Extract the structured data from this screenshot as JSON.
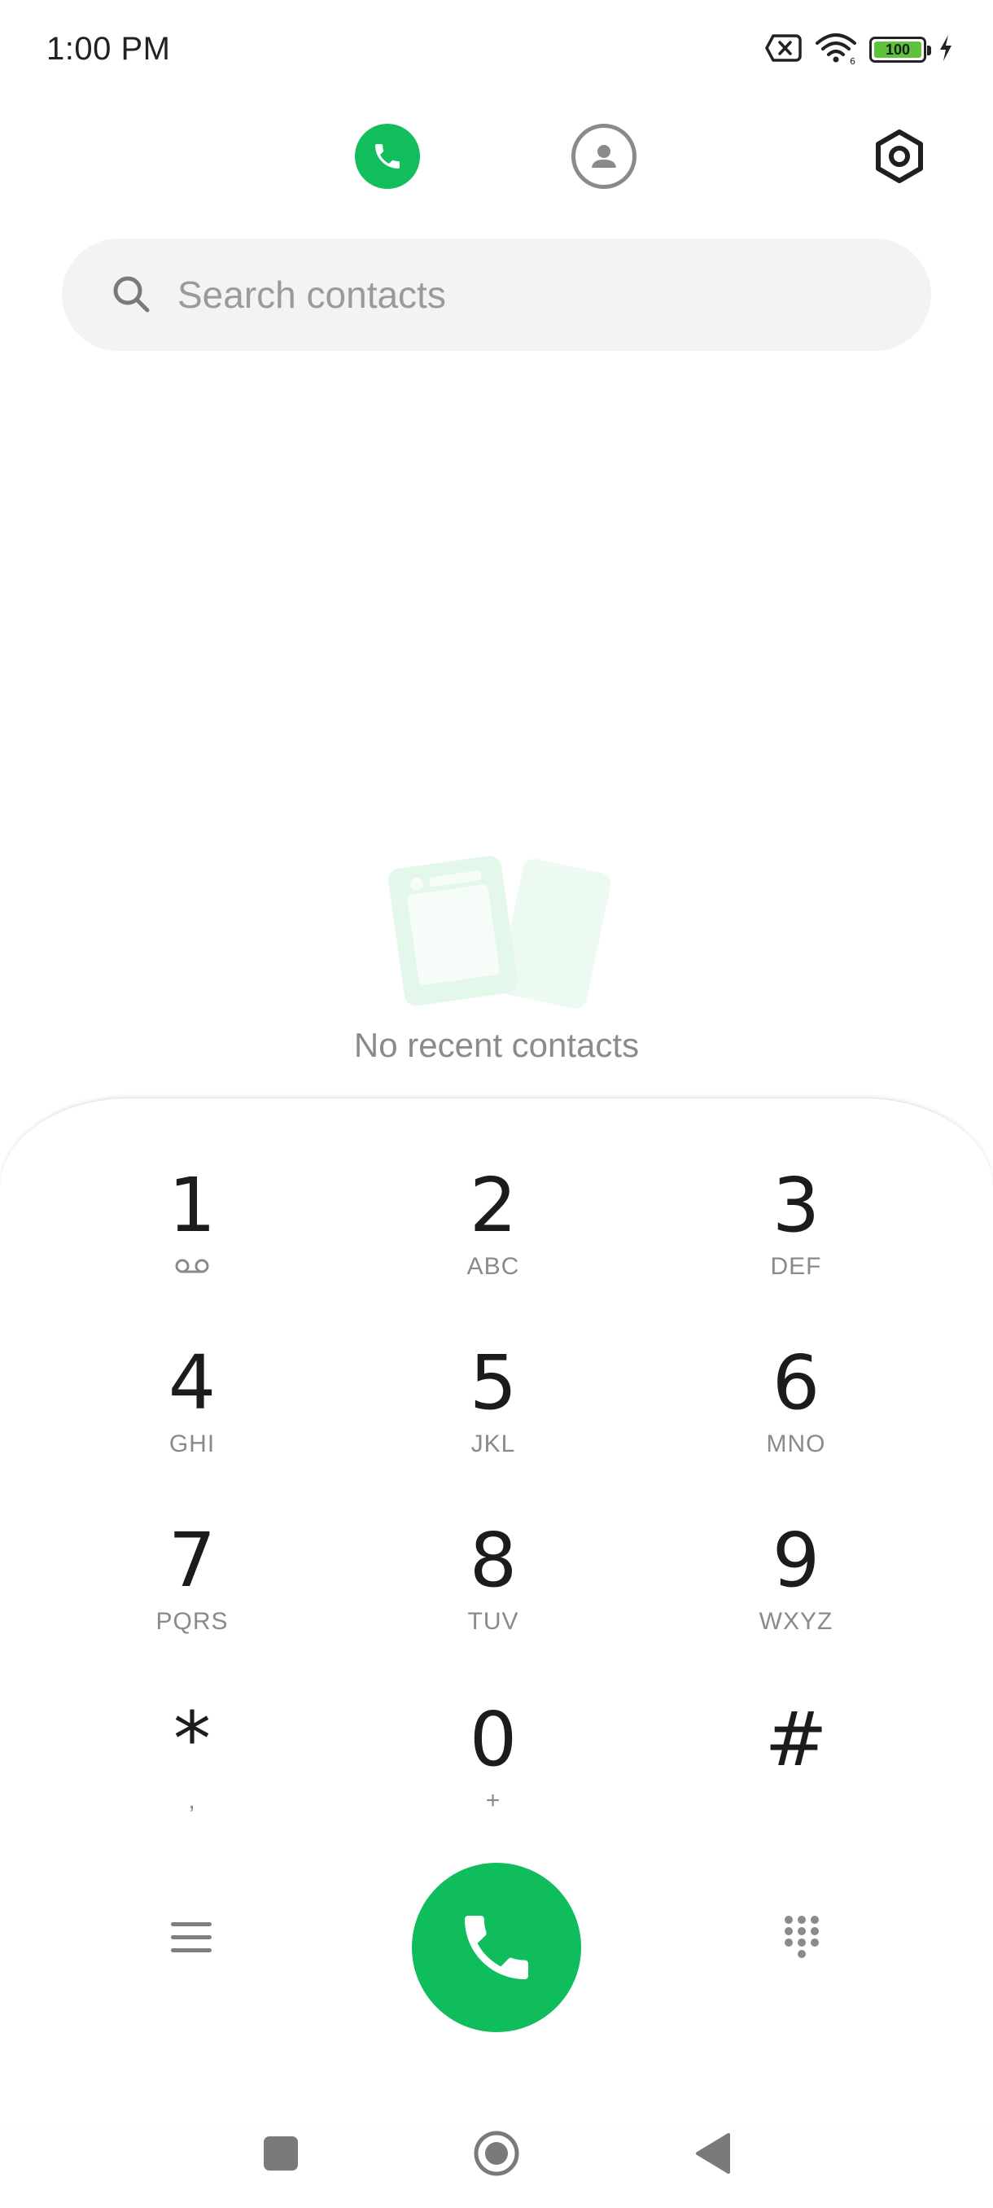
{
  "status_bar": {
    "time": "1:00 PM",
    "battery_level": "100",
    "icons": [
      "no-sim-icon",
      "wifi-icon",
      "battery-icon",
      "charging-icon"
    ]
  },
  "top_nav": {
    "tabs": [
      {
        "name": "recents",
        "icon": "phone-icon",
        "active": true
      },
      {
        "name": "contacts",
        "icon": "contact-icon",
        "active": false
      }
    ],
    "settings_icon": "gear-icon"
  },
  "search": {
    "placeholder": "Search contacts",
    "value": ""
  },
  "empty_state": {
    "text": "No recent contacts"
  },
  "dialpad": {
    "keys": [
      {
        "digit": "1",
        "letters": ""
      },
      {
        "digit": "2",
        "letters": "ABC"
      },
      {
        "digit": "3",
        "letters": "DEF"
      },
      {
        "digit": "4",
        "letters": "GHI"
      },
      {
        "digit": "5",
        "letters": "JKL"
      },
      {
        "digit": "6",
        "letters": "MNO"
      },
      {
        "digit": "7",
        "letters": "PQRS"
      },
      {
        "digit": "8",
        "letters": "TUV"
      },
      {
        "digit": "9",
        "letters": "WXYZ"
      },
      {
        "digit": "*",
        "letters": ","
      },
      {
        "digit": "0",
        "letters": "+"
      },
      {
        "digit": "#",
        "letters": ""
      }
    ]
  },
  "colors": {
    "accent": "#0fbd5c",
    "search_bg": "#f3f3f3",
    "secondary_text": "#8a8a8a"
  }
}
